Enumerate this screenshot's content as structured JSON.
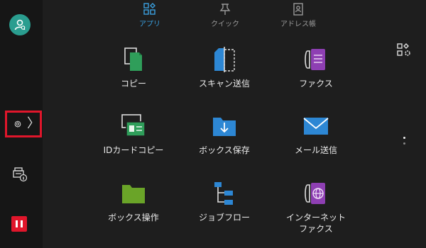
{
  "tabs": [
    {
      "label": "アプリ",
      "icon": "apps-icon",
      "active": true
    },
    {
      "label": "クイック",
      "icon": "pushpin-icon",
      "active": false
    },
    {
      "label": "アドレス帳",
      "icon": "address-book-icon",
      "active": false
    }
  ],
  "apps": [
    {
      "label": "コピー",
      "icon": "copy-icon"
    },
    {
      "label": "スキャン送信",
      "icon": "scan-send-icon"
    },
    {
      "label": "ファクス",
      "icon": "fax-icon"
    },
    {
      "label": "IDカードコピー",
      "icon": "id-card-copy-icon"
    },
    {
      "label": "ボックス保存",
      "icon": "box-save-icon"
    },
    {
      "label": "メール送信",
      "icon": "email-icon"
    },
    {
      "label": "ボックス操作",
      "icon": "box-operation-icon"
    },
    {
      "label": "ジョブフロー",
      "icon": "job-flow-icon"
    },
    {
      "label": "インターネット\nファクス",
      "icon": "internet-fax-icon"
    }
  ],
  "colors": {
    "accent": "#3aa0e0",
    "highlight": "#e0162b",
    "fax_purple": "#8e3fb3",
    "folder_green": "#6aa428",
    "folder_blue": "#2d87d4"
  }
}
